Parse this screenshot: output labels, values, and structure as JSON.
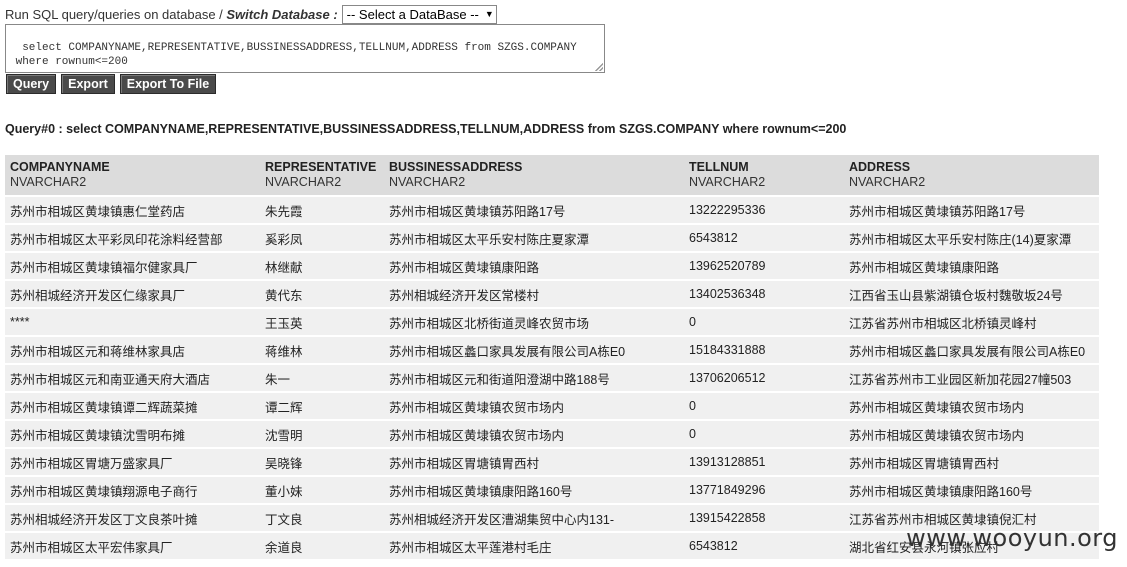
{
  "header": {
    "prompt_text": "Run SQL query/queries on database / ",
    "switch_label": "Switch Database :",
    "db_select_value": "-- Select a DataBase --"
  },
  "sql_editor": {
    "value": "select COMPANYNAME,REPRESENTATIVE,BUSSINESSADDRESS,TELLNUM,ADDRESS from SZGS.COMPANY\n where rownum<=200"
  },
  "buttons": {
    "query": "Query",
    "export": "Export",
    "export_to_file": "Export To File"
  },
  "result": {
    "heading": "Query#0 : select COMPANYNAME,REPRESENTATIVE,BUSSINESSADDRESS,TELLNUM,ADDRESS from SZGS.COMPANY where rownum<=200",
    "columns": [
      {
        "name": "COMPANYNAME",
        "type": "NVARCHAR2"
      },
      {
        "name": "REPRESENTATIVE",
        "type": "NVARCHAR2"
      },
      {
        "name": "BUSSINESSADDRESS",
        "type": "NVARCHAR2"
      },
      {
        "name": "TELLNUM",
        "type": "NVARCHAR2"
      },
      {
        "name": "ADDRESS",
        "type": "NVARCHAR2"
      }
    ],
    "rows": [
      [
        "苏州市相城区黄埭镇惠仁堂药店",
        "朱先霞",
        "苏州市相城区黄埭镇苏阳路17号",
        "13222295336",
        "苏州市相城区黄埭镇苏阳路17号"
      ],
      [
        "苏州市相城区太平彩凤印花涂料经营部",
        "奚彩凤",
        "苏州市相城区太平乐安村陈庄夏家潭",
        "6543812",
        "苏州市相城区太平乐安村陈庄(14)夏家潭"
      ],
      [
        "苏州市相城区黄埭镇福尔健家具厂",
        "林继献",
        "苏州市相城区黄埭镇康阳路",
        "13962520789",
        "苏州市相城区黄埭镇康阳路"
      ],
      [
        "苏州相城经济开发区仁缘家具厂",
        "黄代东",
        "苏州相城经济开发区常楼村",
        "13402536348",
        "江西省玉山县紫湖镇仓坂村魏敬坂24号"
      ],
      [
        "****",
        "王玉英",
        "苏州市相城区北桥街道灵峰农贸市场",
        "0",
        "江苏省苏州市相城区北桥镇灵峰村"
      ],
      [
        "苏州市相城区元和蒋维林家具店",
        "蒋维林",
        "苏州市相城区蠡口家具发展有限公司A栋E0",
        "15184331888",
        "苏州市相城区蠡口家具发展有限公司A栋E0"
      ],
      [
        "苏州市相城区元和南亚通天府大酒店",
        "朱一",
        "苏州市相城区元和街道阳澄湖中路188号",
        "13706206512",
        "江苏省苏州市工业园区新加花园27幢503"
      ],
      [
        "苏州市相城区黄埭镇谭二辉蔬菜摊",
        "谭二辉",
        "苏州市相城区黄埭镇农贸市场内",
        "0",
        "苏州市相城区黄埭镇农贸市场内"
      ],
      [
        "苏州市相城区黄埭镇沈雪明布摊",
        "沈雪明",
        "苏州市相城区黄埭镇农贸市场内",
        "0",
        "苏州市相城区黄埭镇农贸市场内"
      ],
      [
        "苏州市相城区胃塘万盛家具厂",
        "吴晓锋",
        "苏州市相城区胃塘镇胃西村",
        "13913128851",
        "苏州市相城区胃塘镇胃西村"
      ],
      [
        "苏州市相城区黄埭镇翔源电子商行",
        "董小妹",
        "苏州市相城区黄埭镇康阳路160号",
        "13771849296",
        "苏州市相城区黄埭镇康阳路160号"
      ],
      [
        "苏州相城经济开发区丁文良茶叶摊",
        "丁文良",
        "苏州相城经济开发区漕湖集贸中心内131-",
        "13915422858",
        "江苏省苏州市相城区黄埭镇倪汇村"
      ],
      [
        "苏州市相城区太平宏伟家具厂",
        "余道良",
        "苏州市相城区太平莲港村毛庄",
        "6543812",
        "湖北省红安县永河镇张应村"
      ]
    ]
  },
  "watermark": "www.wooyun.org"
}
